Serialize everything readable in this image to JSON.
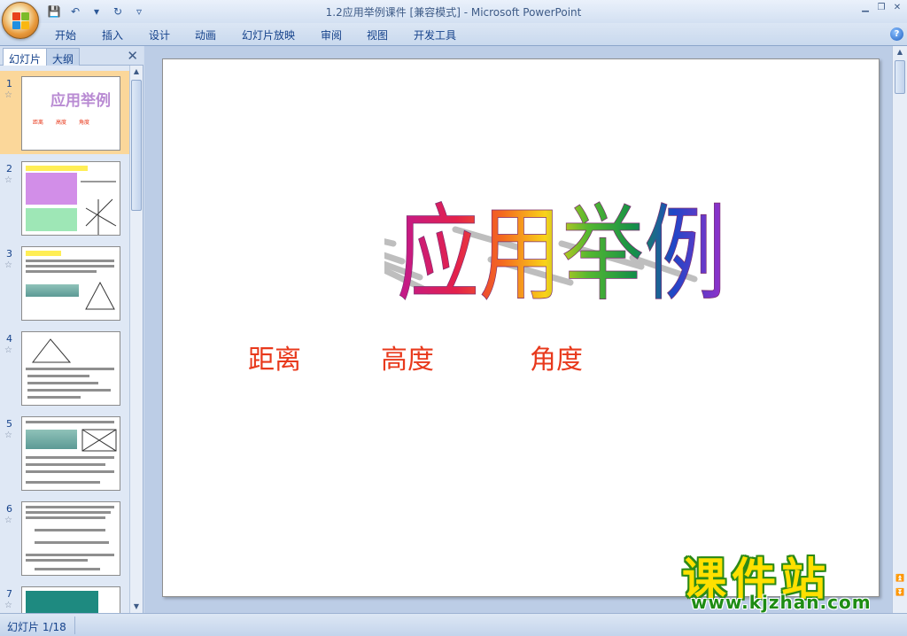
{
  "titlebar": {
    "title": "1.2应用举例课件 [兼容模式] - Microsoft PowerPoint",
    "qat": [
      {
        "name": "save-icon",
        "glyph": "💾"
      },
      {
        "name": "undo-icon",
        "glyph": "↶"
      },
      {
        "name": "dropdown-icon",
        "glyph": "▾"
      },
      {
        "name": "redo-icon",
        "glyph": "↻"
      },
      {
        "name": "customize-icon",
        "glyph": "▿"
      }
    ],
    "controls": [
      "▁",
      "❐",
      "✕"
    ]
  },
  "ribbon": {
    "tabs": [
      "开始",
      "插入",
      "设计",
      "动画",
      "幻灯片放映",
      "审阅",
      "视图",
      "开发工具"
    ],
    "help": "?"
  },
  "leftpanel": {
    "tabs": [
      "幻灯片",
      "大纲"
    ],
    "close": "✕",
    "thumbs": [
      {
        "num": "1",
        "star": "☆",
        "title": "应用举例",
        "subs": [
          "距离",
          "高度",
          "角度"
        ]
      },
      {
        "num": "2",
        "star": "☆"
      },
      {
        "num": "3",
        "star": "☆"
      },
      {
        "num": "4",
        "star": "☆"
      },
      {
        "num": "5",
        "star": "☆"
      },
      {
        "num": "6",
        "star": "☆"
      },
      {
        "num": "7",
        "star": "☆"
      }
    ]
  },
  "slide": {
    "title": "应用举例",
    "subtitles": [
      "距离",
      "高度",
      "角度"
    ]
  },
  "watermark": {
    "big": "课件站",
    "small": "www.kjzhan.com"
  },
  "status": {
    "slide_info": "幻灯片 1/18"
  },
  "colors": {
    "accent": "#15428b",
    "subtitle": "#e8391c",
    "selected_thumb": "#fbd79a"
  }
}
